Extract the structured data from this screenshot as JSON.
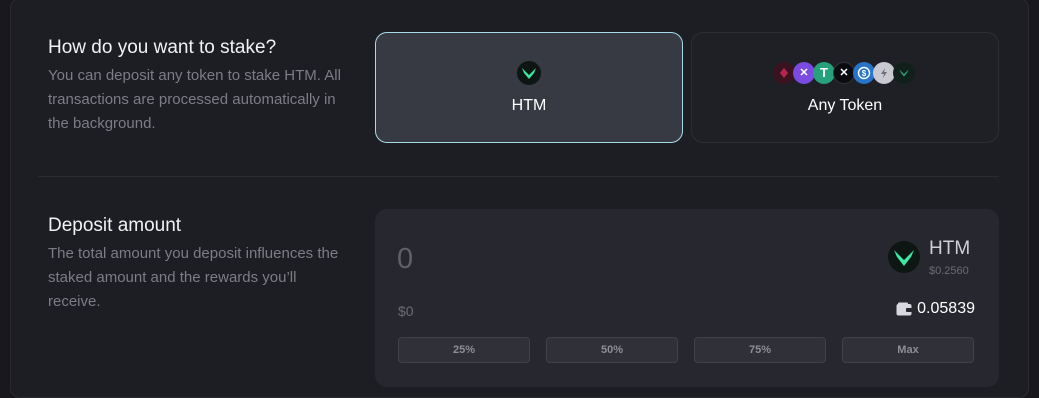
{
  "stake_method": {
    "title": "How do you want to stake?",
    "description": "You can deposit any token to stake HTM. All transactions are processed automatically in the background.",
    "options": [
      {
        "label": "HTM",
        "icon": "htm-token-icon",
        "selected": true
      },
      {
        "label": "Any Token",
        "icons": [
          "dot-icon",
          "xmr-icon",
          "usdt-icon",
          "xrp-icon",
          "usdc-icon",
          "gas-icon",
          "htm-token-icon"
        ],
        "selected": false
      }
    ]
  },
  "deposit": {
    "title": "Deposit amount",
    "description": "The total amount you deposit influences the staked amount and the rewards you’ll receive.",
    "amount_placeholder": "0",
    "usd_value": "$0",
    "token": {
      "symbol": "HTM",
      "price": "$0.2560"
    },
    "balance": "0.05839",
    "quick_buttons": [
      "25%",
      "50%",
      "75%",
      "Max"
    ]
  },
  "colors": {
    "accent_teal": "#3ee8a4",
    "selected_border": "#a8dbe8"
  }
}
